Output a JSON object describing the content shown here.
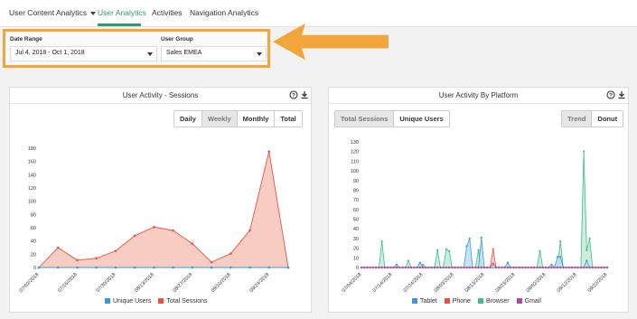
{
  "nav": {
    "items": [
      {
        "label": "User Content Analytics",
        "x": 10,
        "dropdown": true,
        "active": false
      },
      {
        "label": "User Analytics",
        "x": 108,
        "dropdown": false,
        "active": true
      },
      {
        "label": "Activities",
        "x": 168,
        "dropdown": false,
        "active": false
      },
      {
        "label": "Navigation Analytics",
        "x": 210,
        "dropdown": false,
        "active": false
      }
    ]
  },
  "filters": {
    "date_range_label": "Date Range",
    "date_range_value": "Jul 4, 2018 - Oct 1, 2018",
    "user_group_label": "User Group",
    "user_group_value": "Sales EMEA"
  },
  "panels": {
    "sessions": {
      "title": "User Activity - Sessions",
      "buttons": [
        "Daily",
        "Weekly",
        "Monthly",
        "Total"
      ],
      "selected": "Weekly",
      "legend": [
        {
          "name": "Unique Users",
          "color": "#3a9ad9"
        },
        {
          "name": "Total Sessions",
          "color": "#e8523f"
        }
      ]
    },
    "platform": {
      "title": "User Activity By Platform",
      "left_buttons": [
        "Total Sessions",
        "Unique Users"
      ],
      "left_selected": "Total Sessions",
      "right_buttons": [
        "Trend",
        "Donut"
      ],
      "right_selected": "Trend",
      "legend": [
        {
          "name": "Tablet",
          "color": "#3a9ad9"
        },
        {
          "name": "Phone",
          "color": "#e8523f"
        },
        {
          "name": "Browser",
          "color": "#3dbf86"
        },
        {
          "name": "Gmail",
          "color": "#a64ca6"
        }
      ]
    }
  },
  "icons": {
    "help": "help-circle-icon",
    "download": "download-icon"
  },
  "chart_data": [
    {
      "type": "area",
      "x": [
        "07/02/2018",
        "07/09/2018",
        "07/16/2018",
        "07/23/2018",
        "07/30/2018",
        "08/06/2018",
        "08/13/2018",
        "08/20/2018",
        "08/27/2018",
        "09/03/2018",
        "09/10/2018",
        "09/17/2018",
        "09/24/2018",
        "10/01/2018"
      ],
      "tick_labels": [
        "07/02/2018",
        "07/16/2018",
        "07/30/2018",
        "08/13/2018",
        "08/27/2018",
        "09/10/2018",
        "09/24/2018"
      ],
      "series": [
        {
          "name": "Total Sessions",
          "values": [
            0,
            30,
            11,
            14,
            25,
            48,
            61,
            56,
            36,
            8,
            21,
            56,
            175,
            0
          ]
        },
        {
          "name": "Unique Users",
          "values": [
            0,
            0,
            0,
            0,
            0,
            0,
            0,
            0,
            0,
            0,
            0,
            0,
            0,
            0
          ]
        }
      ],
      "ylim": [
        0,
        180
      ],
      "yticks": [
        0,
        20,
        40,
        60,
        80,
        100,
        120,
        140,
        160,
        180
      ]
    },
    {
      "type": "area",
      "tick_labels": [
        "07/04/2018",
        "07/14/2018",
        "07/24/2018",
        "08/03/2018",
        "08/13/2018",
        "08/23/2018",
        "09/02/2018",
        "09/12/2018",
        "09/22/2018"
      ],
      "ylim": [
        0,
        130
      ],
      "yticks": [
        0,
        10,
        20,
        30,
        40,
        50,
        60,
        70,
        80,
        90,
        100,
        110,
        120,
        130
      ],
      "series": [
        {
          "name": "Browser",
          "values": [
            0,
            0,
            0,
            0,
            0,
            0,
            0,
            27,
            0,
            0,
            0,
            0,
            0,
            0,
            0,
            0,
            7,
            0,
            0,
            0,
            0,
            3,
            0,
            0,
            0,
            0,
            18,
            0,
            0,
            19,
            17,
            0,
            0,
            0,
            0,
            0,
            0,
            0,
            0,
            0,
            18,
            0,
            0,
            0,
            0,
            0,
            0,
            0,
            0,
            0,
            0,
            0,
            0,
            0,
            0,
            0,
            0,
            0,
            0,
            0,
            0,
            17,
            0,
            0,
            0,
            0,
            0,
            0,
            27,
            0,
            0,
            0,
            0,
            0,
            0,
            0,
            120,
            18,
            30,
            0,
            0,
            0,
            0,
            0,
            0
          ]
        },
        {
          "name": "Tablet",
          "values": [
            0,
            0,
            0,
            0,
            0,
            0,
            0,
            0,
            0,
            0,
            0,
            0,
            3,
            0,
            0,
            0,
            0,
            0,
            0,
            0,
            5,
            0,
            0,
            0,
            0,
            0,
            0,
            0,
            0,
            0,
            0,
            0,
            0,
            0,
            0,
            0,
            22,
            30,
            0,
            0,
            0,
            31,
            0,
            0,
            0,
            0,
            0,
            0,
            0,
            0,
            5,
            0,
            0,
            0,
            0,
            0,
            0,
            0,
            0,
            0,
            0,
            0,
            0,
            0,
            0,
            3,
            0,
            11,
            11,
            0,
            0,
            0,
            0,
            0,
            0,
            0,
            0,
            7,
            0,
            0,
            0,
            0,
            0,
            0,
            0
          ]
        },
        {
          "name": "Phone",
          "values": [
            0,
            0,
            0,
            0,
            0,
            0,
            0,
            0,
            0,
            0,
            0,
            0,
            0,
            0,
            0,
            0,
            0,
            0,
            0,
            0,
            0,
            0,
            0,
            0,
            0,
            0,
            0,
            0,
            0,
            0,
            0,
            0,
            0,
            0,
            0,
            0,
            0,
            0,
            0,
            0,
            0,
            0,
            0,
            0,
            0,
            19,
            0,
            0,
            0,
            0,
            0,
            0,
            0,
            0,
            0,
            0,
            0,
            0,
            0,
            0,
            0,
            0,
            0,
            0,
            0,
            0,
            0,
            0,
            0,
            0,
            0,
            0,
            0,
            0,
            0,
            0,
            0,
            0,
            0,
            0,
            0,
            0,
            0,
            0,
            0
          ]
        },
        {
          "name": "Gmail",
          "values": [
            0,
            0,
            0,
            0,
            0,
            0,
            0,
            0,
            0,
            0,
            0,
            0,
            0,
            0,
            0,
            0,
            0,
            0,
            0,
            0,
            0,
            0,
            0,
            0,
            0,
            0,
            0,
            0,
            0,
            0,
            0,
            0,
            0,
            0,
            0,
            0,
            0,
            0,
            0,
            0,
            0,
            0,
            0,
            0,
            0,
            4,
            0,
            0,
            0,
            0,
            0,
            0,
            0,
            0,
            0,
            0,
            0,
            0,
            0,
            0,
            0,
            0,
            0,
            0,
            0,
            0,
            0,
            0,
            0,
            0,
            0,
            0,
            0,
            0,
            0,
            0,
            0,
            0,
            0,
            0,
            0,
            0,
            0,
            0,
            0
          ]
        }
      ]
    }
  ]
}
